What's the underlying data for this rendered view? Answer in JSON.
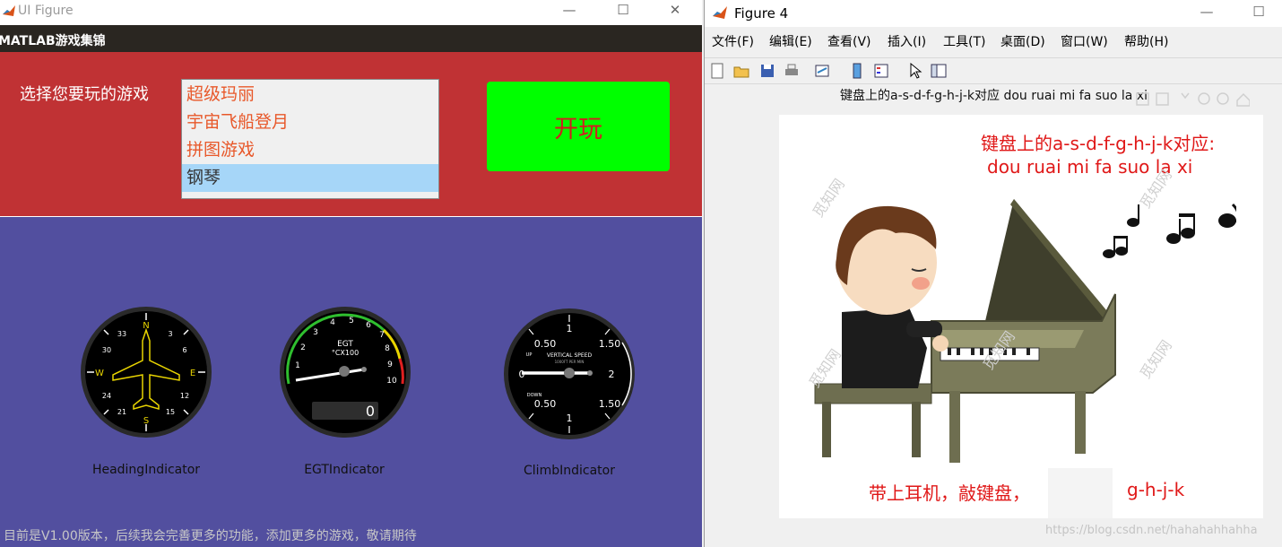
{
  "left_window": {
    "title": "UI Figure",
    "menubar_title": "MATLAB游戏集锦",
    "prompt_label": "选择您要玩的游戏",
    "games": [
      "超级玛丽",
      "宇宙飞船登月",
      "拼图游戏",
      "钢琴"
    ],
    "selected_game": "钢琴",
    "play_button": "开玩",
    "gauges": [
      {
        "label": "HeadingIndicator",
        "value": "N"
      },
      {
        "label": "EGTIndicator",
        "title": "EGT",
        "subtitle": "°CX100",
        "readout": "0",
        "ticks": [
          "1",
          "2",
          "3",
          "4",
          "5",
          "6",
          "7",
          "8",
          "9",
          "10"
        ]
      },
      {
        "label": "ClimbIndicator",
        "title": "VERTICAL SPEED",
        "subtitle": "1000FT PER MIN",
        "up": "UP",
        "down": "DOWN",
        "ticks": [
          "0",
          "0.50",
          "1",
          "1.50",
          "2",
          "1.50",
          "1",
          "0.50"
        ]
      }
    ],
    "footer": "目前是V1.00版本，后续我会完善更多的功能，添加更多的游戏，敬请期待",
    "colors": {
      "red_panel": "#c03234",
      "blue_panel": "#524f9f",
      "play_button": "#00ff00"
    }
  },
  "right_window": {
    "title": "Figure 4",
    "menu": [
      "文件(F)",
      "编辑(E)",
      "查看(V)",
      "插入(I)",
      "工具(T)",
      "桌面(D)",
      "窗口(W)",
      "帮助(H)"
    ],
    "axes_title": "键盘上的a-s-d-f-g-h-j-k对应 dou ruai mi fa suo la xi",
    "image_text_line1": "键盘上的a-s-d-f-g-h-j-k对应:",
    "image_text_line2": "dou ruai mi fa suo la xi",
    "image_text_bottom_left": "带上耳机，敲键盘，",
    "image_text_bottom_right": "g-h-j-k",
    "watermark": "觅知网",
    "footer_watermark": "https://blog.csdn.net/hahahahhahha"
  }
}
